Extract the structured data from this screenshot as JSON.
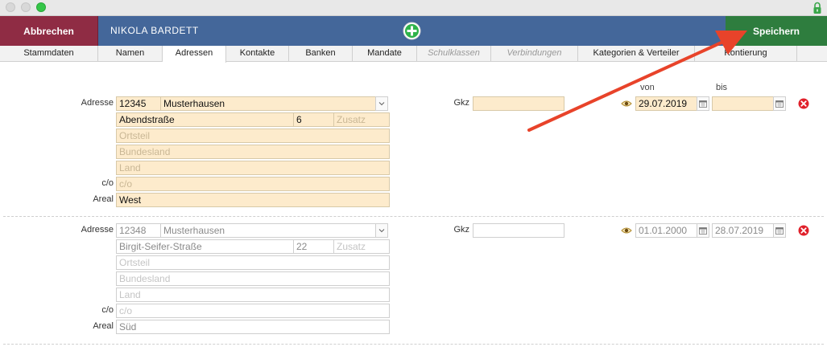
{
  "window": {
    "controls": [
      "close",
      "minimize",
      "maximize"
    ],
    "lock_icon": "lock-icon"
  },
  "actionbar": {
    "cancel_label": "Abbrechen",
    "person_name": "NIKOLA  BARDETT",
    "add_icon": "plus-circle-icon",
    "save_label": "Speichern"
  },
  "tabs": [
    {
      "label": "Stammdaten",
      "active": false,
      "disabled": false
    },
    {
      "label": "Namen",
      "active": false,
      "disabled": false
    },
    {
      "label": "Adressen",
      "active": true,
      "disabled": false
    },
    {
      "label": "Kontakte",
      "active": false,
      "disabled": false
    },
    {
      "label": "Banken",
      "active": false,
      "disabled": false
    },
    {
      "label": "Mandate",
      "active": false,
      "disabled": false
    },
    {
      "label": "Schulklassen",
      "active": false,
      "disabled": true
    },
    {
      "label": "Verbindungen",
      "active": false,
      "disabled": true
    },
    {
      "label": "Kategorien & Verteiler",
      "active": false,
      "disabled": false
    },
    {
      "label": "Kontierung",
      "active": false,
      "disabled": false
    }
  ],
  "columns": {
    "von": "von",
    "bis": "bis"
  },
  "labels": {
    "adresse": "Adresse",
    "gkz": "Gkz",
    "co": "c/o",
    "areal": "Areal"
  },
  "addresses": [
    {
      "active": true,
      "plz": "12345",
      "ort": "Musterhausen",
      "strasse": "Abendstraße",
      "hausnummer": "6",
      "zusatz_placeholder": "Zusatz",
      "ortsteil_placeholder": "Ortsteil",
      "bundesland_placeholder": "Bundesland",
      "land_placeholder": "Land",
      "co_placeholder": "c/o",
      "areal": "West",
      "gkz": "",
      "von": "29.07.2019",
      "bis": ""
    },
    {
      "active": false,
      "plz": "12348",
      "ort": "Musterhausen",
      "strasse": "Birgit-Seifer-Straße",
      "hausnummer": "22",
      "zusatz_placeholder": "Zusatz",
      "ortsteil_placeholder": "Ortsteil",
      "bundesland_placeholder": "Bundesland",
      "land_placeholder": "Land",
      "co_placeholder": "c/o",
      "areal": "Süd",
      "gkz": "",
      "von": "01.01.2000",
      "bis": "28.07.2019"
    }
  ],
  "colors": {
    "cancel": "#8f2c44",
    "bar": "#44679a",
    "save": "#2e7d3e",
    "field": "#fdebcc",
    "annotation_arrow": "#e8432a"
  }
}
